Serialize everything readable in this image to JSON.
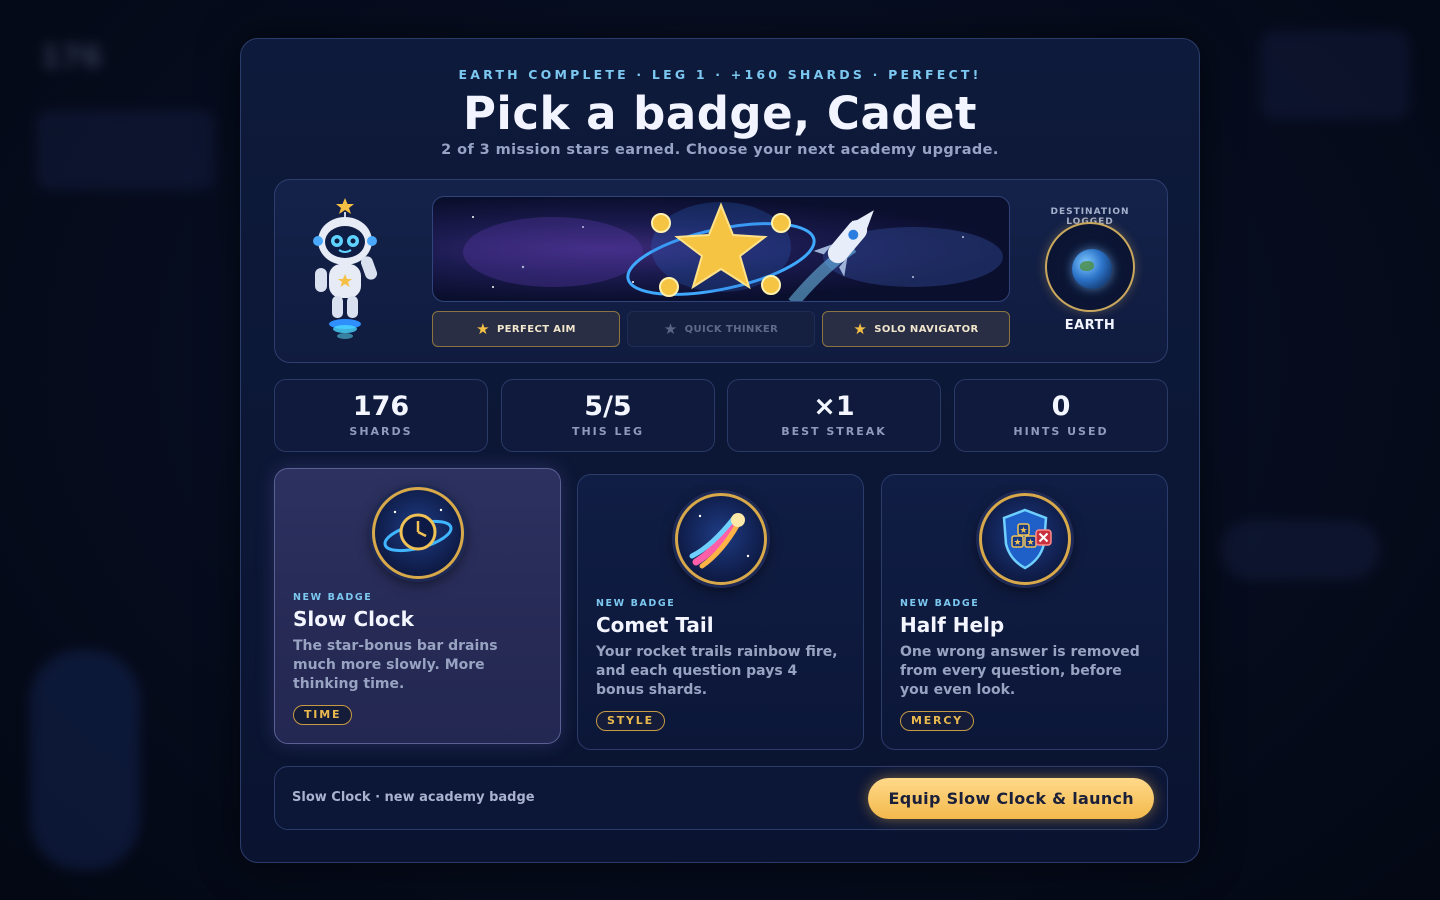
{
  "header": {
    "eyebrow": "EARTH COMPLETE · LEG 1 · +160 SHARDS · PERFECT!",
    "title": "Pick a badge, Cadet",
    "subtitle": "2 of 3 mission stars earned. Choose your next academy upgrade."
  },
  "hero": {
    "mission_stars": [
      {
        "label": "PERFECT AIM",
        "earned": true,
        "icon": "star-icon"
      },
      {
        "label": "QUICK THINKER",
        "earned": false,
        "icon": "star-icon"
      },
      {
        "label": "SOLO NAVIGATOR",
        "earned": true,
        "icon": "star-icon"
      }
    ],
    "destination": {
      "label": "DESTINATION LOGGED",
      "name": "EARTH",
      "icon": "earth-planet-icon"
    }
  },
  "stats": [
    {
      "value": "176",
      "label": "SHARDS"
    },
    {
      "value": "5/5",
      "label": "THIS LEG"
    },
    {
      "value": "×1",
      "label": "BEST STREAK"
    },
    {
      "value": "0",
      "label": "HINTS USED"
    }
  ],
  "badges": [
    {
      "tag": "NEW BADGE",
      "name": "Slow Clock",
      "description": "The star-bonus bar drains much more slowly. More thinking time.",
      "category": "TIME",
      "icon": "clock-planet-icon",
      "selected": true
    },
    {
      "tag": "NEW BADGE",
      "name": "Comet Tail",
      "description": "Your rocket trails rainbow fire, and each question pays 4 bonus shards.",
      "category": "STYLE",
      "icon": "comet-icon",
      "selected": false
    },
    {
      "tag": "NEW BADGE",
      "name": "Half Help",
      "description": "One wrong answer is removed from every question, before you even look.",
      "category": "MERCY",
      "icon": "shield-icon",
      "selected": false
    }
  ],
  "footer": {
    "summary": "Slow Clock · new academy badge",
    "launch_label": "Equip Slow Clock & launch"
  },
  "background": {
    "score": "176"
  },
  "colors": {
    "accent": "#7cc8f0",
    "gold": "#f3b94c",
    "panel": "#0e1a3b"
  }
}
